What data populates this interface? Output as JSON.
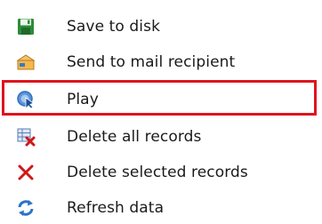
{
  "menu": {
    "items": [
      {
        "label": "Save to disk",
        "icon": "floppy-disk-icon"
      },
      {
        "label": "Send to mail recipient",
        "icon": "mail-envelope-icon"
      },
      {
        "label": "Play",
        "icon": "play-cursor-icon"
      },
      {
        "label": "Delete all records",
        "icon": "delete-all-records-icon"
      },
      {
        "label": "Delete selected records",
        "icon": "delete-selected-x-icon"
      },
      {
        "label": "Refresh data",
        "icon": "refresh-icon"
      }
    ]
  },
  "highlight": {
    "target": "Play",
    "color": "#e0141e"
  },
  "colors": {
    "save_icon": "#2e8b3a",
    "mail_icon": "#e8a23a",
    "play_icon": "#2f6fc0",
    "delete_x": "#d01818",
    "refresh_icon": "#2a74c8"
  }
}
